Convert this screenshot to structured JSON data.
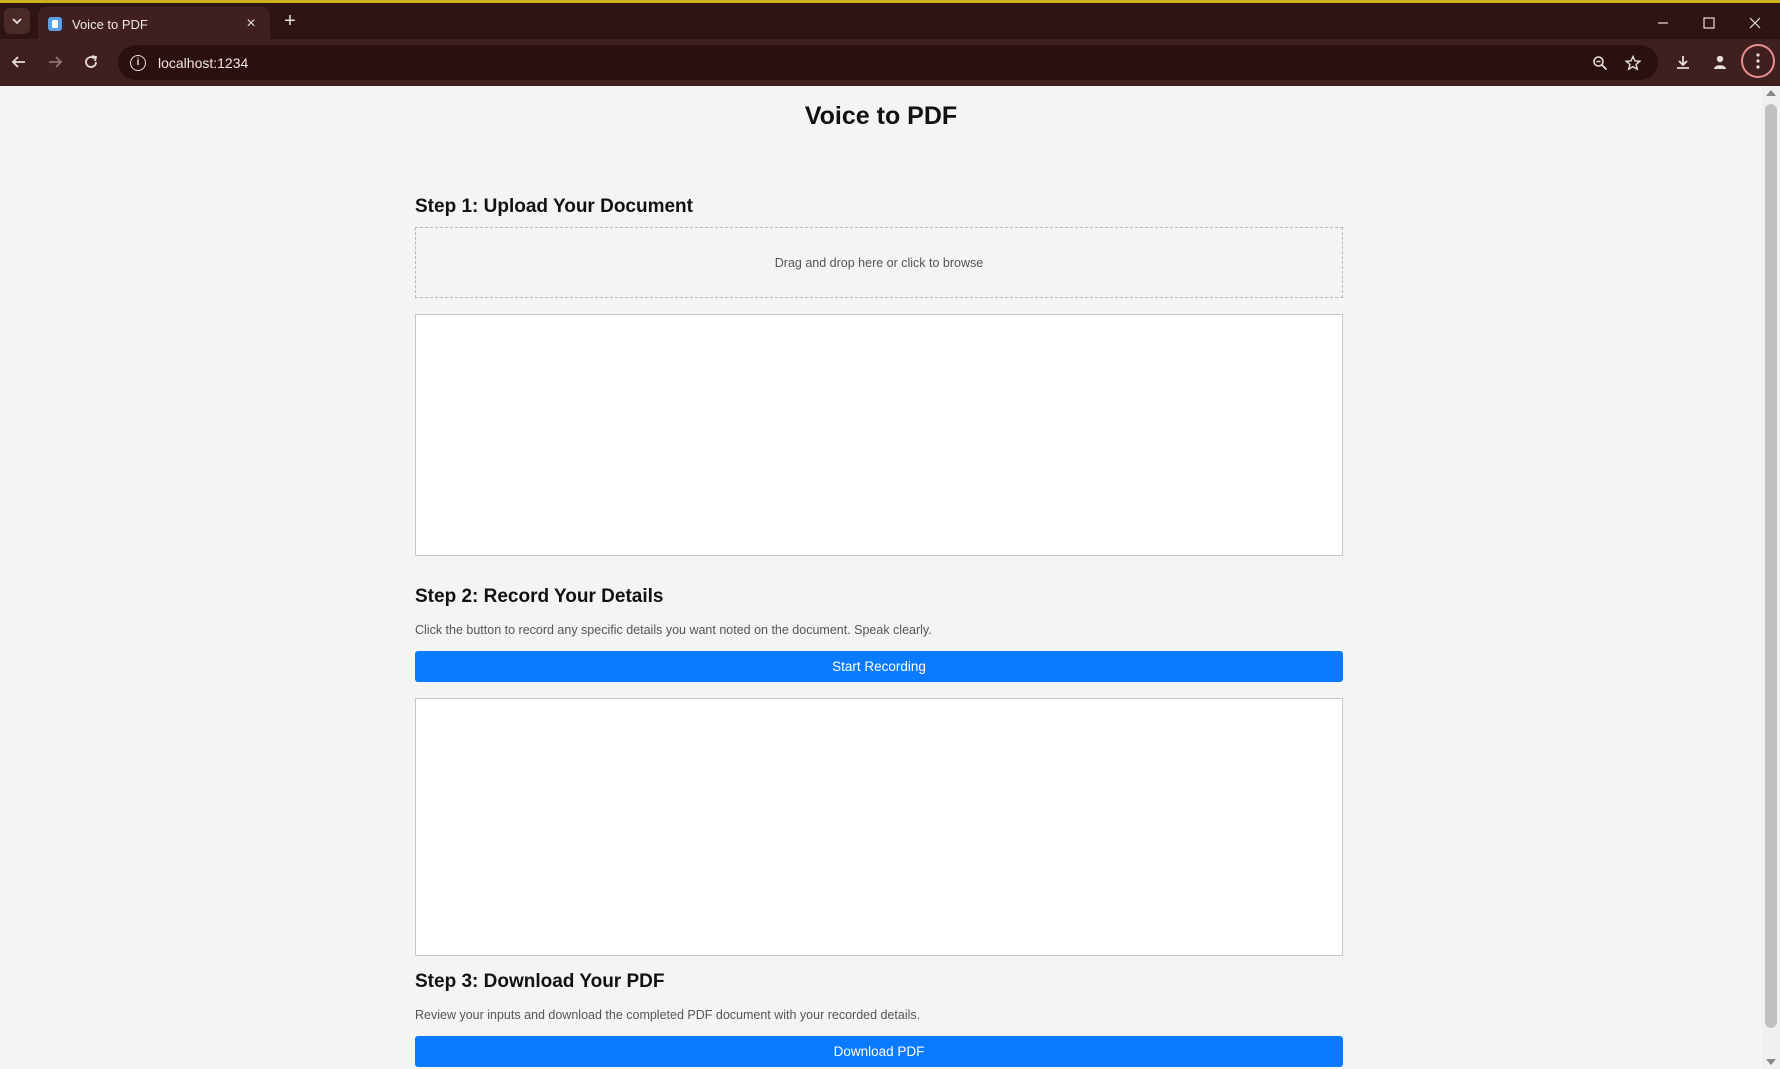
{
  "browser": {
    "tab_title": "Voice to PDF",
    "url": "localhost:1234"
  },
  "page": {
    "title": "Voice to PDF",
    "step1": {
      "title": "Step 1: Upload Your Document",
      "dropzone_text": "Drag and drop here or click to browse"
    },
    "step2": {
      "title": "Step 2: Record Your Details",
      "description": "Click the button to record any specific details you want noted on the document. Speak clearly.",
      "button_label": "Start Recording"
    },
    "step3": {
      "title": "Step 3: Download Your PDF",
      "description": "Review your inputs and download the completed PDF document with your recorded details.",
      "button_label": "Download PDF"
    }
  },
  "colors": {
    "accent": "#0a7bff",
    "page_bg": "#f4f4f4",
    "chrome_bg": "#3f201e"
  }
}
